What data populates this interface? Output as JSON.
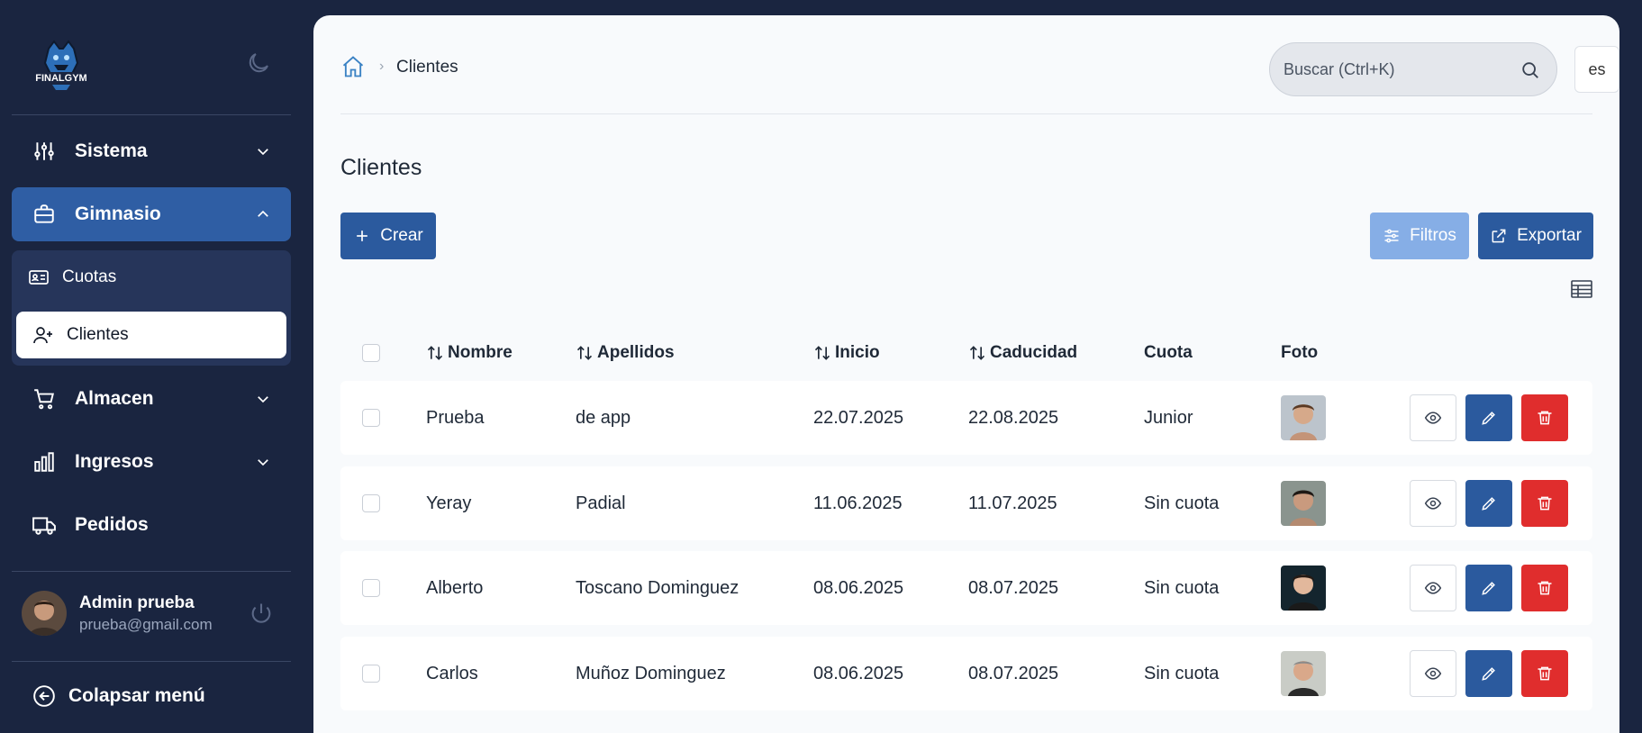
{
  "sidebar": {
    "logo_text": "FINALGYM",
    "nav": [
      {
        "label": "Sistema",
        "icon": "sliders-icon"
      },
      {
        "label": "Gimnasio",
        "icon": "briefcase-icon"
      },
      {
        "label": "Almacen",
        "icon": "cart-icon"
      },
      {
        "label": "Ingresos",
        "icon": "bar-chart-icon"
      },
      {
        "label": "Pedidos",
        "icon": "truck-icon"
      }
    ],
    "submenu": [
      {
        "label": "Cuotas",
        "icon": "id-card-icon"
      },
      {
        "label": "Clientes",
        "icon": "user-plus-icon"
      }
    ],
    "user": {
      "name": "Admin prueba",
      "email": "prueba@gmail.com"
    },
    "collapse_label": "Colapsar menú"
  },
  "header": {
    "breadcrumb": "Clientes",
    "search_placeholder": "Buscar (Ctrl+K)",
    "language": "es"
  },
  "page": {
    "title": "Clientes",
    "create_label": "Crear",
    "filters_label": "Filtros",
    "export_label": "Exportar"
  },
  "table": {
    "columns": [
      "Nombre",
      "Apellidos",
      "Inicio",
      "Caducidad",
      "Cuota",
      "Foto"
    ],
    "rows": [
      {
        "nombre": "Prueba",
        "apellidos": "de app",
        "inicio": "22.07.2025",
        "caducidad": "22.08.2025",
        "cuota": "Junior"
      },
      {
        "nombre": "Yeray",
        "apellidos": "Padial",
        "inicio": "11.06.2025",
        "caducidad": "11.07.2025",
        "cuota": "Sin cuota"
      },
      {
        "nombre": "Alberto",
        "apellidos": "Toscano Dominguez",
        "inicio": "08.06.2025",
        "caducidad": "08.07.2025",
        "cuota": "Sin cuota"
      },
      {
        "nombre": "Carlos",
        "apellidos": "Muñoz Dominguez",
        "inicio": "08.06.2025",
        "caducidad": "08.07.2025",
        "cuota": "Sin cuota"
      }
    ]
  },
  "colors": {
    "sidebar_bg": "#1a2540",
    "primary": "#2b5a9e",
    "filters": "#86aee6",
    "danger": "#e02d2d"
  }
}
